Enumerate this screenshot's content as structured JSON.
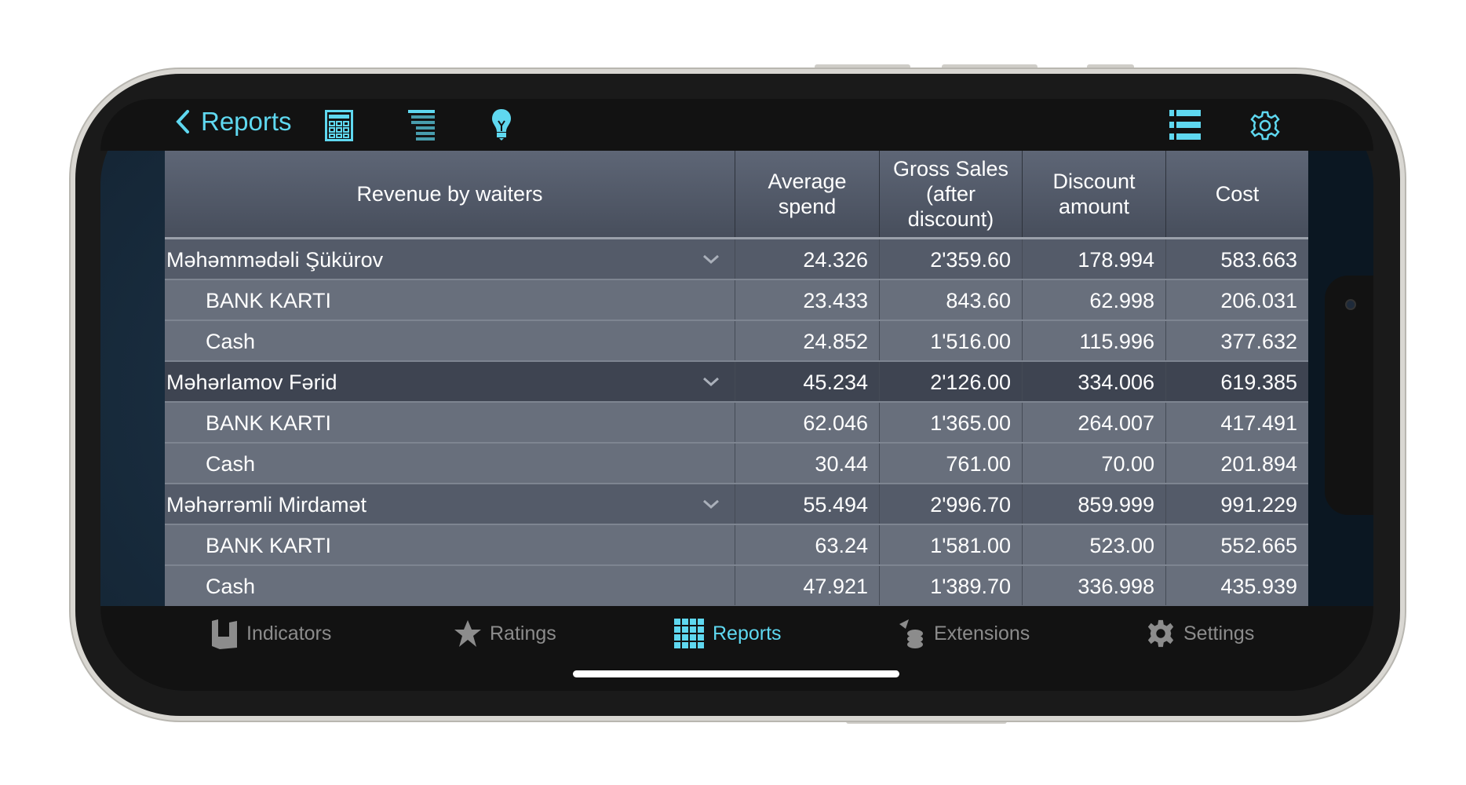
{
  "topbar": {
    "back_label": "Reports",
    "accent": "#5fd8f0"
  },
  "table": {
    "headers": [
      "Revenue by waiters",
      "Average spend",
      "Gross Sales (after discount)",
      "Discount amount",
      "Cost"
    ],
    "rows": [
      {
        "type": "group",
        "name": "Məhəmmədəli Şükürov",
        "values": [
          "24.326",
          "2'359.60",
          "178.994",
          "583.663"
        ]
      },
      {
        "type": "sub",
        "name": "BANK KARTI",
        "values": [
          "23.433",
          "843.60",
          "62.998",
          "206.031"
        ]
      },
      {
        "type": "sub",
        "name": "Cash",
        "values": [
          "24.852",
          "1'516.00",
          "115.996",
          "377.632"
        ]
      },
      {
        "type": "group",
        "name": "Məhərlamov Fərid",
        "values": [
          "45.234",
          "2'126.00",
          "334.006",
          "619.385"
        ],
        "selected": true
      },
      {
        "type": "sub",
        "name": "BANK KARTI",
        "values": [
          "62.046",
          "1'365.00",
          "264.007",
          "417.491"
        ]
      },
      {
        "type": "sub",
        "name": "Cash",
        "values": [
          "30.44",
          "761.00",
          "70.00",
          "201.894"
        ]
      },
      {
        "type": "group",
        "name": "Məhərrəmli Mirdamət",
        "values": [
          "55.494",
          "2'996.70",
          "859.999",
          "991.229"
        ]
      },
      {
        "type": "sub",
        "name": "BANK KARTI",
        "values": [
          "63.24",
          "1'581.00",
          "523.00",
          "552.665"
        ]
      },
      {
        "type": "sub",
        "name": "Cash",
        "values": [
          "47.921",
          "1'389.70",
          "336.998",
          "435.939"
        ]
      }
    ]
  },
  "tabs": [
    {
      "label": "Indicators",
      "icon": "indicators-icon"
    },
    {
      "label": "Ratings",
      "icon": "star-icon"
    },
    {
      "label": "Reports",
      "icon": "grid-icon",
      "active": true
    },
    {
      "label": "Extensions",
      "icon": "coins-icon"
    },
    {
      "label": "Settings",
      "icon": "gear-icon"
    }
  ]
}
